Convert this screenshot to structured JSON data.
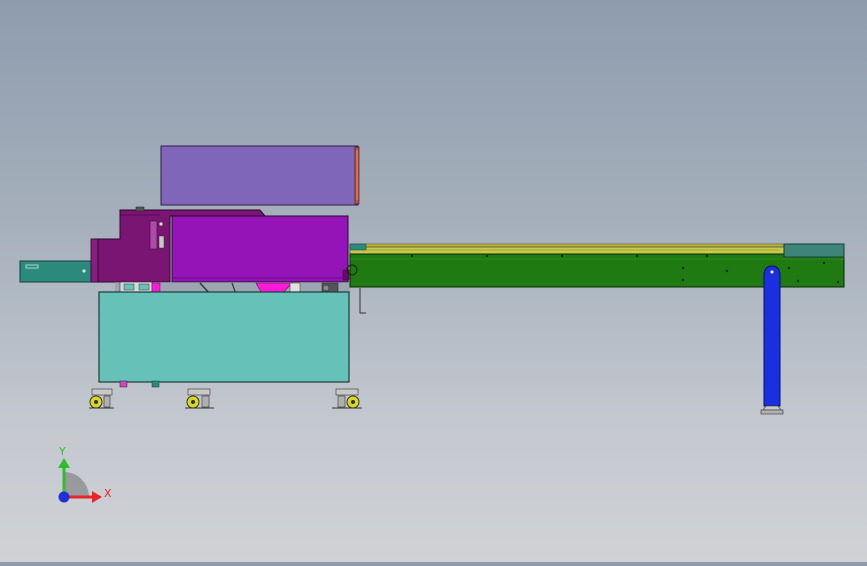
{
  "triad": {
    "x_label": "X",
    "y_label": "Y",
    "x_color": "#e8262a",
    "y_color": "#2dbf2d",
    "origin_color": "#1f2fd9"
  },
  "colors": {
    "background_top": "#8e9cae",
    "background_bottom": "#d0d2d6",
    "hood_top": "#7f66b8",
    "hood_main": "#9414b8",
    "hood_dark": "#7a1574",
    "base_cabinet": "#66c2b8",
    "conveyor": "#1f7a12",
    "conveyor_rail": "#b8b840",
    "infeed_block": "#2b8a7c",
    "end_cap": "#3e8478",
    "support_leg": "#1a2fe0",
    "accent_magenta": "#ff1ad9",
    "caster_yellow": "#d8d820"
  }
}
